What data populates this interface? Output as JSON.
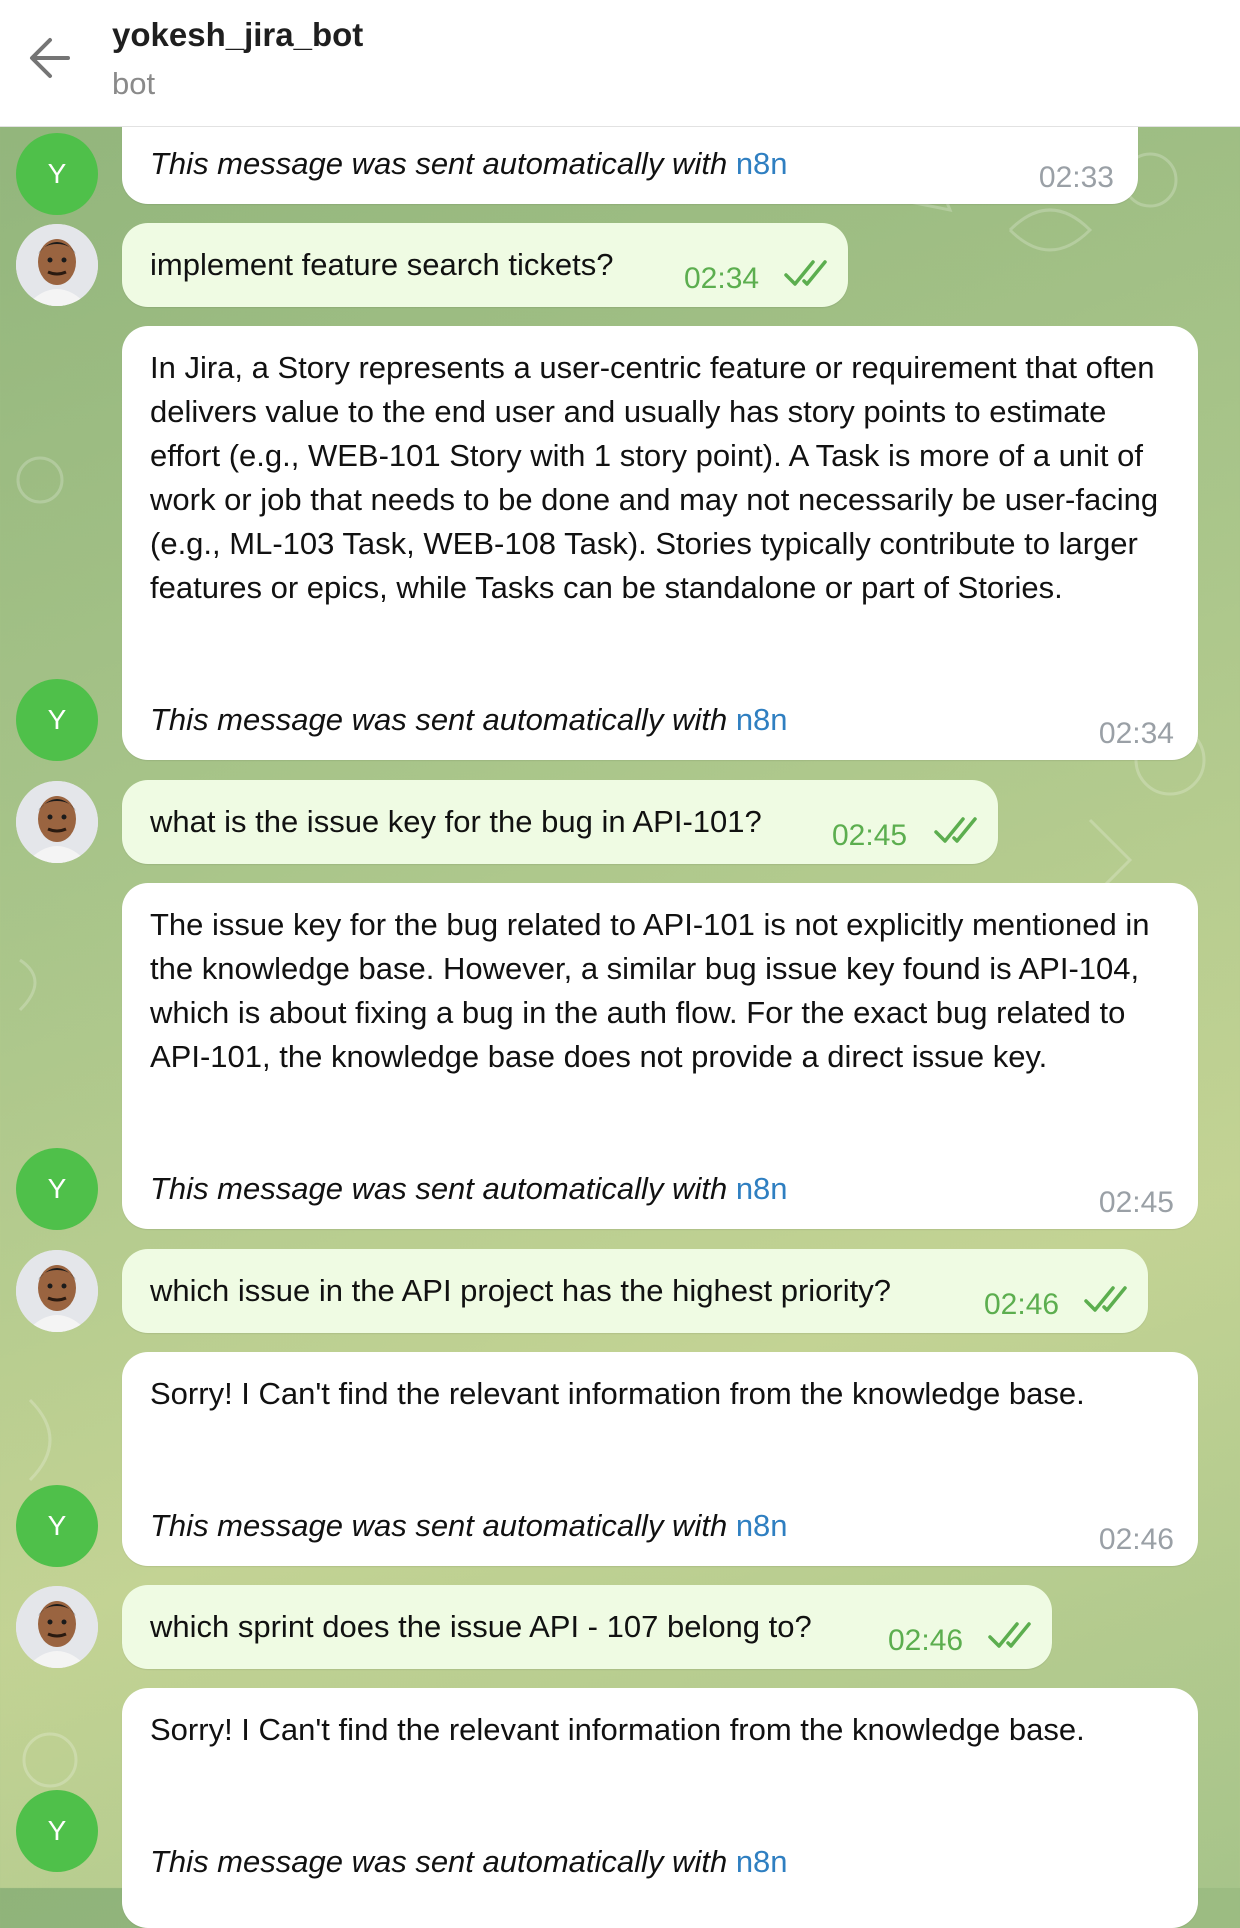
{
  "header": {
    "title": "yokesh_jira_bot",
    "subtitle": "bot",
    "back_icon": "arrow-left-icon"
  },
  "bot_avatar_letter": "Y",
  "auto_prefix": "This message was sent automatically with",
  "auto_link": "n8n",
  "messages": [
    {
      "from": "bot",
      "time": "02:33"
    },
    {
      "from": "user",
      "text": "implement feature search tickets?",
      "time": "02:34",
      "status": "read"
    },
    {
      "from": "bot",
      "text": "In Jira, a Story represents a user-centric feature or requirement that often delivers value to the end user and usually has story points to estimate effort (e.g., WEB-101 Story with 1 story point). A Task is more of a unit of work or job that needs to be done and may not necessarily be user-facing (e.g., ML-103 Task, WEB-108 Task). Stories typically contribute to larger features or epics, while Tasks can be standalone or part of Stories.",
      "time": "02:34"
    },
    {
      "from": "user",
      "text": "what is the issue key for the bug in API-101?",
      "time": "02:45",
      "status": "read"
    },
    {
      "from": "bot",
      "text": "The issue key for the bug related to API-101 is not explicitly mentioned in the knowledge base. However, a similar bug issue key found is API-104, which is about fixing a bug in the auth flow. For the exact bug related to API-101, the knowledge base does not provide a direct issue key.",
      "time": "02:45"
    },
    {
      "from": "user",
      "text": "which issue in the API project has the highest priority?",
      "time": "02:46",
      "status": "read"
    },
    {
      "from": "bot",
      "text": "Sorry! I Can't find the relevant information from the knowledge base.",
      "time": "02:46"
    },
    {
      "from": "user",
      "text": "which sprint does the issue API - 107 belong to?",
      "time": "02:46",
      "status": "read"
    },
    {
      "from": "bot",
      "text": "Sorry! I Can't find the relevant information from the knowledge base.",
      "time": ""
    }
  ],
  "colors": {
    "incoming": "#ffffff",
    "outgoing": "#effbe3",
    "read_ticks": "#5cae4f",
    "link": "#2f7fc1",
    "bot_avatar": "#4fc04a"
  }
}
